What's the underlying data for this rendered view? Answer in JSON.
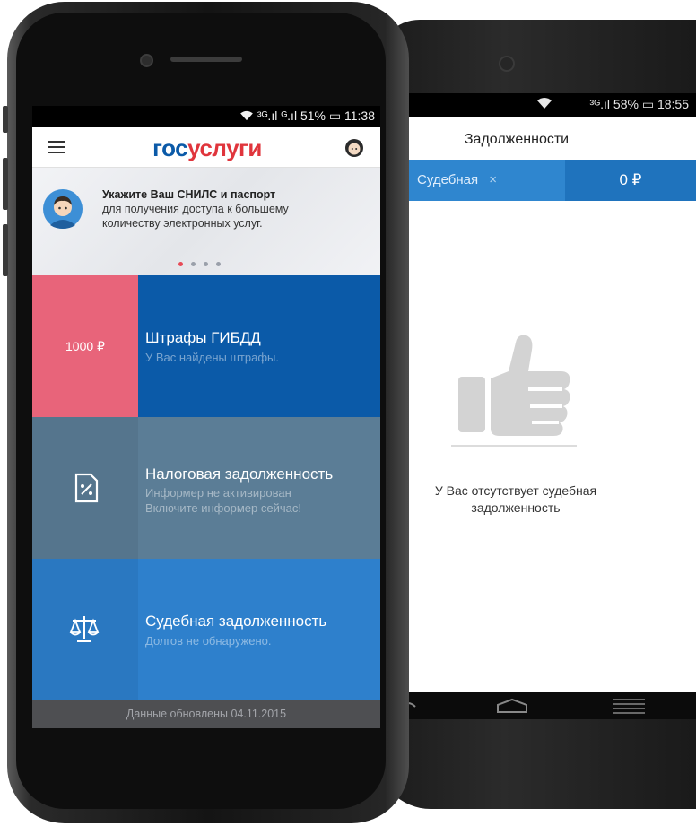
{
  "iphone": {
    "status": {
      "signal": "³ᴳ.ıl ᴳ.ıl",
      "battery": "51%",
      "time": "11:38"
    },
    "header": {
      "logo_part1": "гос",
      "logo_part2": "услуги"
    },
    "banner": {
      "line1": "Укажите Ваш СНИЛС и паспорт",
      "line2": "для получения доступа к большему",
      "line3": "количеству электронных услуг.",
      "active_slide": 1,
      "slides": 4
    },
    "tiles": [
      {
        "amount": "1000 ₽",
        "title": "Штрафы ГИБДД",
        "subtitle": "У Вас найдены штрафы."
      },
      {
        "title": "Налоговая задолженность",
        "subtitle_line1": "Информер не активирован",
        "subtitle_line2": "Включите информер сейчас!",
        "icon": "tax-document-icon"
      },
      {
        "title": "Судебная задолженность",
        "subtitle": "Долгов не обнаружено.",
        "icon": "scales-icon"
      }
    ],
    "footer": "Данные обновлены 04.11.2015"
  },
  "android": {
    "status": {
      "signal": "³ᴳ.ıl",
      "battery": "58%",
      "time": "18:55"
    },
    "title": "Задолженности",
    "tab": {
      "label": "Судебная",
      "close": "×",
      "amount": "0 ₽"
    },
    "empty_line1": "У Вас отсутствует судебная",
    "empty_line2": "задолженность"
  },
  "colors": {
    "brand_blue": "#0b5aa8",
    "brand_red": "#e0353c",
    "fines_pink": "#e8647a",
    "tax_gray_blue": "#5b7d96",
    "court_blue": "#2e80cc"
  }
}
